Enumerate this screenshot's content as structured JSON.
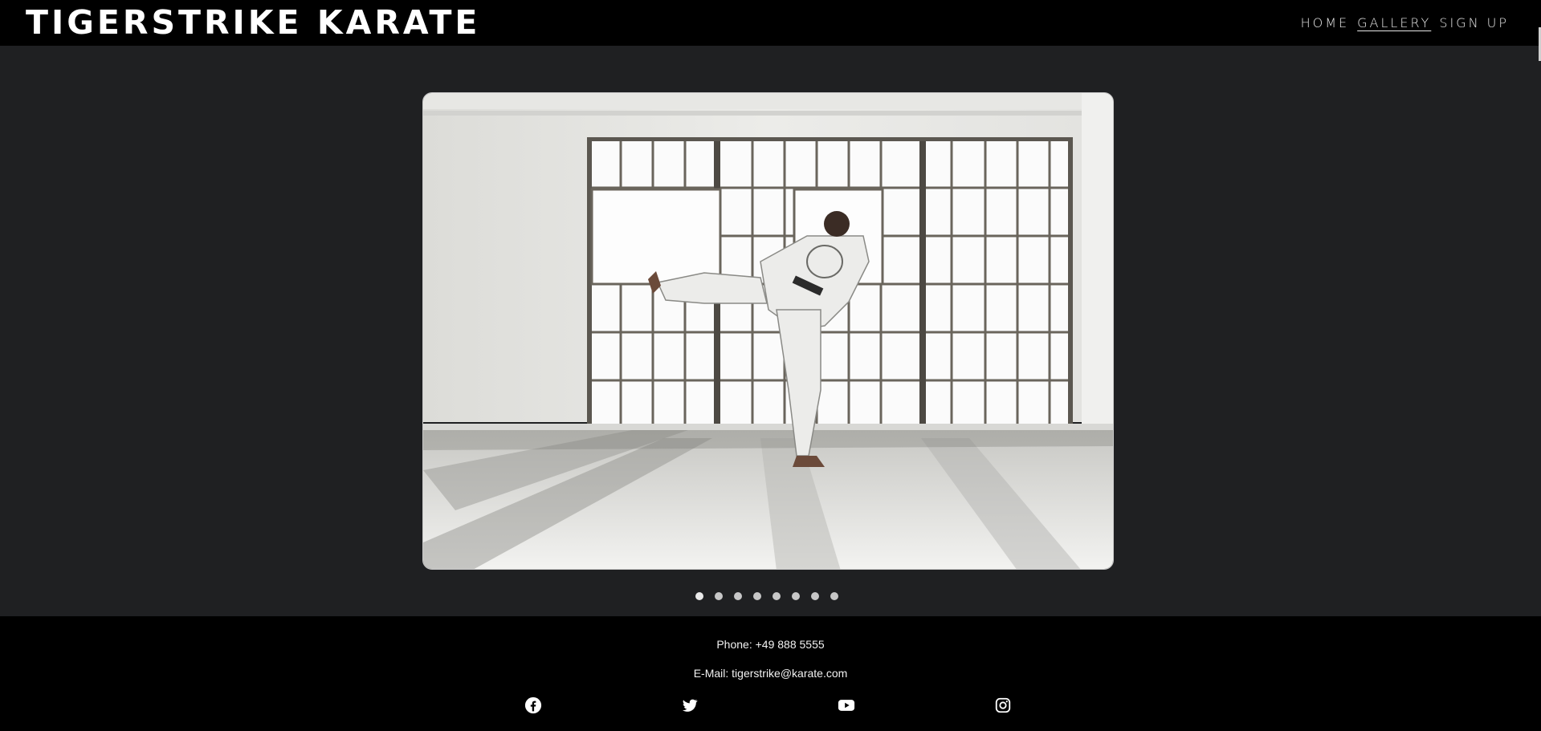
{
  "site": {
    "title": "TIGERSTRIKE KARATE"
  },
  "nav": {
    "items": [
      {
        "label": "HOME",
        "active": false
      },
      {
        "label": "GALLERY",
        "active": true
      },
      {
        "label": "SIGN UP",
        "active": false
      }
    ]
  },
  "gallery": {
    "slide_count": 8,
    "active_index": 0,
    "image_description": "karate-side-kick-photo"
  },
  "footer": {
    "phone": "Phone: +49 888 5555",
    "email": "E-Mail: tigerstrike@karate.com",
    "social": [
      "facebook-icon",
      "twitter-icon",
      "youtube-icon",
      "instagram-icon"
    ]
  },
  "colors": {
    "header_bg": "#000000",
    "page_bg": "#1f2022",
    "text": "#ffffff",
    "dot": "#c7c7c7"
  }
}
